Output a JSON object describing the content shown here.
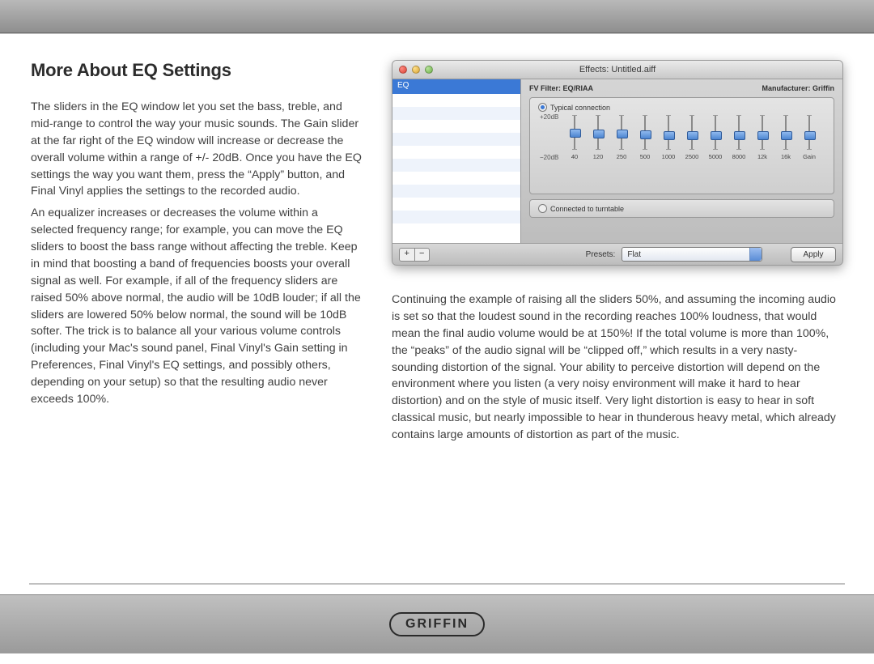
{
  "page": {
    "title": "More About EQ Settings",
    "para1": "The sliders in the EQ window let you set the bass, treble, and mid-range to control the way your music sounds. The Gain slider at the far right of the EQ window will increase or decrease the overall volume within a range of +/- 20dB. Once you have the EQ settings the way you want them, press the “Apply” button, and Final Vinyl applies the settings to the recorded audio.",
    "para2": "An equalizer increases or decreases the volume within a selected frequency range; for example, you can move the EQ sliders to boost the bass range without affecting the treble. Keep in mind that boosting a band of frequencies boosts your overall signal as well. For example, if all of the frequency sliders are raised 50% above normal, the audio will be 10dB louder; if all the sliders are lowered 50% below normal, the sound will be 10dB softer. The trick is to balance all your various volume controls (including your Mac's sound panel, Final Vinyl's Gain setting in Preferences, Final Vinyl's EQ settings, and possibly others, depending on your setup) so that the resulting audio never exceeds 100%.",
    "para3": "Continuing the example of raising all the sliders 50%, and assuming the incoming audio is set so that the loudest sound in the recording reaches 100% loudness, that would mean the final audio volume would be at 150%! If the total volume is more than 100%, the “peaks” of the audio signal will be “clipped off,” which results in a very nasty-sounding distortion of the signal. Your ability to perceive distortion will depend on the environment where you listen (a very noisy environment will make it hard to hear distortion) and on the style of music itself. Very light distortion is easy to hear in soft classical music, but nearly impossible to hear in thunderous heavy metal, which already contains large amounts of distortion as part of the music."
  },
  "fx": {
    "window_title": "Effects: Untitled.aiff",
    "sidebar_selected": "EQ",
    "filter_label": "FV Filter: EQ/RIAA",
    "manufacturer_label": "Manufacturer: Griffin",
    "radio_typical": "Typical connection",
    "radio_turntable": "Connected to turntable",
    "db_top": "+20dB",
    "db_bot": "−20dB",
    "freqs": [
      "40",
      "120",
      "250",
      "500",
      "1000",
      "2500",
      "5000",
      "8000",
      "12k",
      "16k",
      "Gain"
    ],
    "slider_values": [
      0.38,
      0.4,
      0.42,
      0.44,
      0.46,
      0.46,
      0.46,
      0.46,
      0.46,
      0.46,
      0.46
    ],
    "presets_label": "Presets:",
    "preset_selected": "Flat",
    "apply_label": "Apply",
    "plus": "+",
    "minus": "−"
  },
  "footer": {
    "brand": "GRIFFIN"
  }
}
